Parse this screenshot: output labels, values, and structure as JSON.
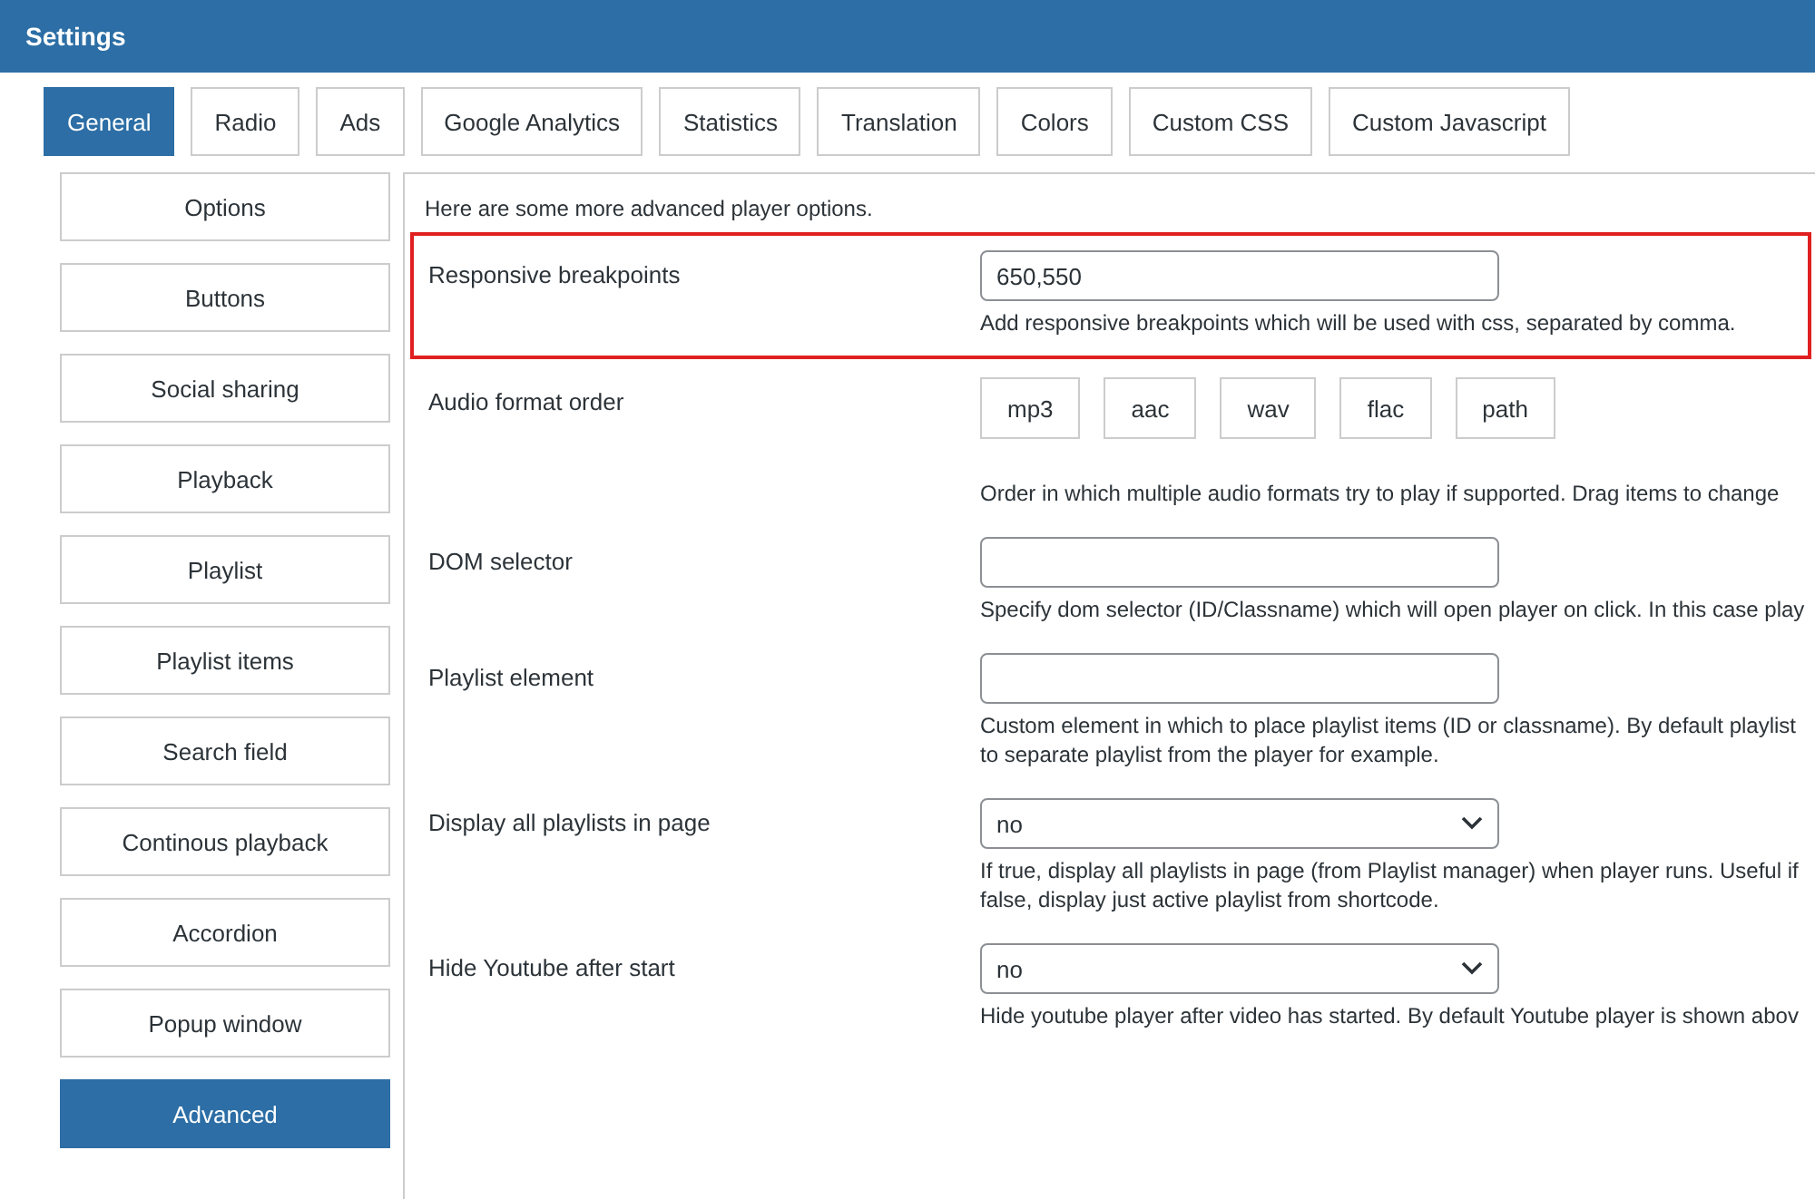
{
  "header": {
    "title": "Settings"
  },
  "tabs": [
    {
      "label": "General",
      "selected": true
    },
    {
      "label": "Radio",
      "selected": false
    },
    {
      "label": "Ads",
      "selected": false
    },
    {
      "label": "Google Analytics",
      "selected": false
    },
    {
      "label": "Statistics",
      "selected": false
    },
    {
      "label": "Translation",
      "selected": false
    },
    {
      "label": "Colors",
      "selected": false
    },
    {
      "label": "Custom CSS",
      "selected": false
    },
    {
      "label": "Custom Javascript",
      "selected": false
    }
  ],
  "sidebar": {
    "items": [
      {
        "label": "Options",
        "selected": false
      },
      {
        "label": "Buttons",
        "selected": false
      },
      {
        "label": "Social sharing",
        "selected": false
      },
      {
        "label": "Playback",
        "selected": false
      },
      {
        "label": "Playlist",
        "selected": false
      },
      {
        "label": "Playlist items",
        "selected": false
      },
      {
        "label": "Search field",
        "selected": false
      },
      {
        "label": "Continous playback",
        "selected": false
      },
      {
        "label": "Accordion",
        "selected": false
      },
      {
        "label": "Popup window",
        "selected": false
      },
      {
        "label": "Advanced",
        "selected": true
      }
    ]
  },
  "panel": {
    "intro": "Here are some more advanced player options.",
    "rows": [
      {
        "kind": "text",
        "label": "Responsive breakpoints",
        "value": "650,550",
        "highlighted": true,
        "description": "Add responsive breakpoints which will be used with css, separated by comma."
      },
      {
        "kind": "chips",
        "label": "Audio format order",
        "chips": [
          "mp3",
          "aac",
          "wav",
          "flac",
          "path"
        ],
        "highlighted": false,
        "description": "Order in which multiple audio formats try to play if supported. Drag items to change"
      },
      {
        "kind": "text",
        "label": "DOM selector",
        "value": "",
        "highlighted": false,
        "description": "Specify dom selector (ID/Classname) which will open player on click. In this case play"
      },
      {
        "kind": "text",
        "label": "Playlist element",
        "value": "",
        "highlighted": false,
        "description": "Custom element in which to place playlist items (ID or classname). By default playlist to separate playlist from the player for example."
      },
      {
        "kind": "select",
        "label": "Display all playlists in page",
        "value": "no",
        "highlighted": false,
        "description": "If true, display all playlists in page (from Playlist manager) when player runs. Useful if false, display just active playlist from shortcode."
      },
      {
        "kind": "select",
        "label": "Hide Youtube after start",
        "value": "no",
        "highlighted": false,
        "description": "Hide youtube player after video has started. By default Youtube player is shown abov"
      }
    ]
  }
}
